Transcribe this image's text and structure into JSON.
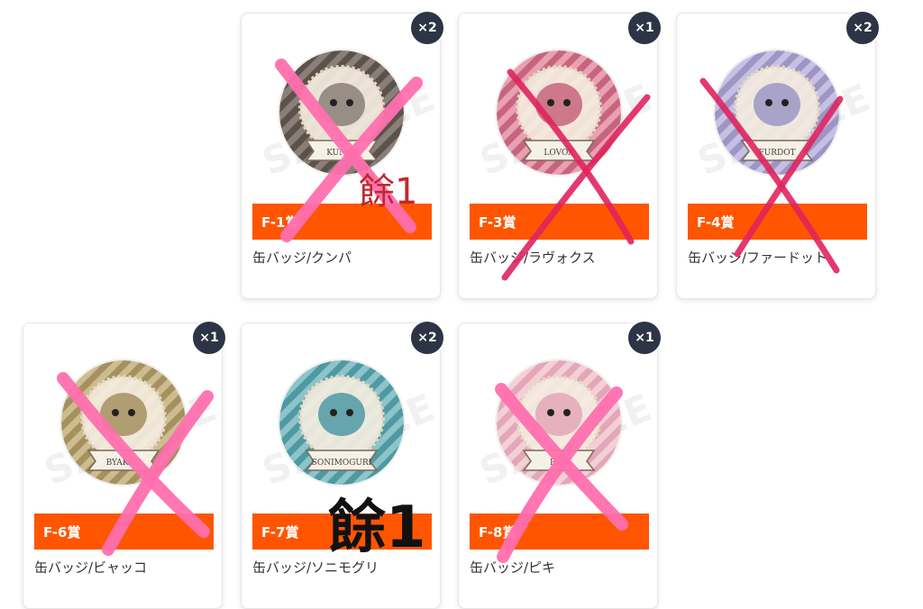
{
  "items": [
    {
      "code": "F-1賞",
      "name": "缶バッジ/クンパ",
      "count": "×2",
      "badge_text": "KUNPA",
      "badge_color": "#8a7f78",
      "stripe_color": "#5c524c",
      "sold_out": false
    },
    {
      "code": "F-3賞",
      "name": "缶バッジ/ラヴォクス",
      "count": "×1",
      "badge_text": "LOVOX",
      "badge_color": "#c7647e",
      "stripe_color": "#e8a0b2",
      "sold_out": true
    },
    {
      "code": "F-4賞",
      "name": "缶バッジ/ファードット",
      "count": "×2",
      "badge_text": "FURDOT",
      "badge_color": "#9d96c4",
      "stripe_color": "#c6c0e4",
      "sold_out": true
    },
    {
      "code": "F-6賞",
      "name": "缶バッジ/ビャッコ",
      "count": "×1",
      "badge_text": "BYAKKO",
      "badge_color": "#a4915f",
      "stripe_color": "#cdbd8e",
      "sold_out": true
    },
    {
      "code": "F-7賞",
      "name": "缶バッジ/ソニモグリ",
      "count": "×2",
      "badge_text": "SONIMOGURI",
      "badge_color": "#4f99a3",
      "stripe_color": "#8cc4ca",
      "sold_out": false
    },
    {
      "code": "F-8賞",
      "name": "缶バッジ/ピキ",
      "count": "×1",
      "badge_text": "PIKI",
      "badge_color": "#e3a7b7",
      "stripe_color": "#f3cfd8",
      "sold_out": true
    }
  ],
  "annotations": {
    "remain_f1": "餘1",
    "remain_f7": "餘1",
    "remain_red_color": "#c0282e",
    "remain_black_color": "#111111",
    "cross_pink_color": "#ff6fae",
    "cross_red_color": "#e0245e"
  },
  "accent_color": "#ff5500",
  "count_badge_color": "#2d3445"
}
